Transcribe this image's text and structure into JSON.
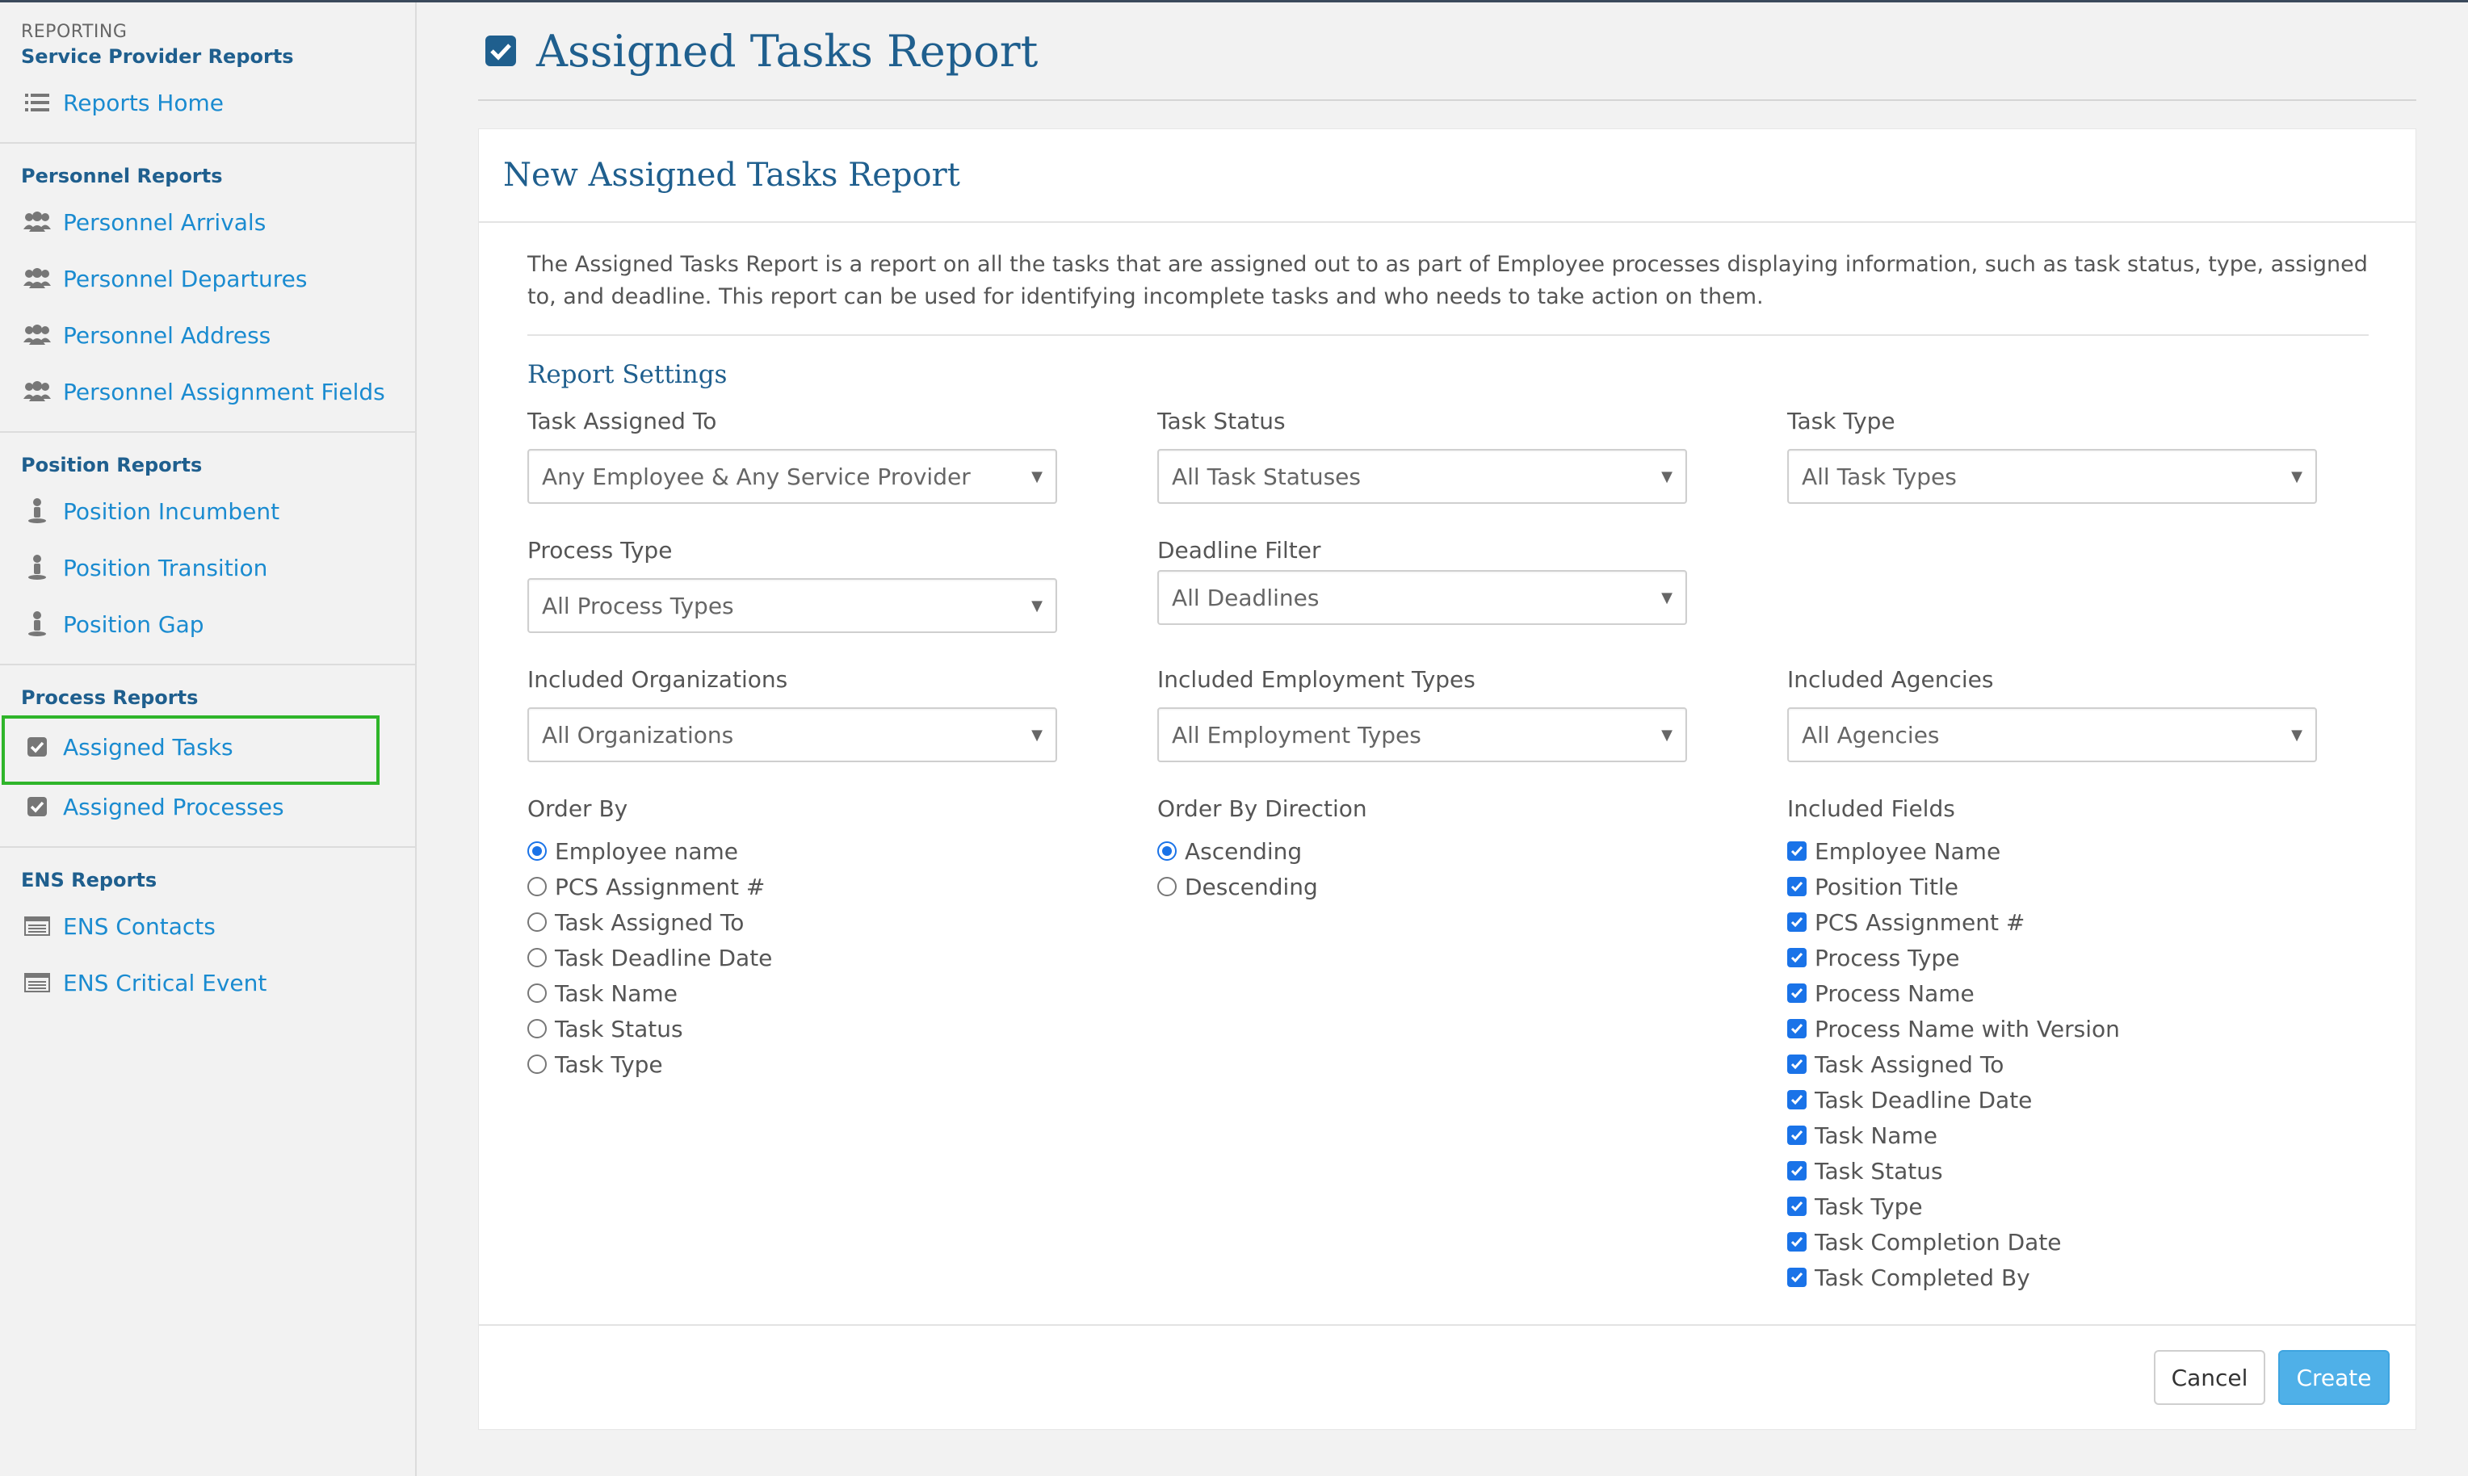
{
  "sidebar": {
    "kicker": "REPORTING",
    "sections": [
      {
        "heading": "Service Provider Reports",
        "items": [
          {
            "label": "Reports Home",
            "icon": "list-icon"
          }
        ]
      },
      {
        "heading": "Personnel Reports",
        "items": [
          {
            "label": "Personnel Arrivals",
            "icon": "users-icon"
          },
          {
            "label": "Personnel Departures",
            "icon": "users-icon"
          },
          {
            "label": "Personnel Address",
            "icon": "users-icon"
          },
          {
            "label": "Personnel Assignment Fields",
            "icon": "users-icon"
          }
        ]
      },
      {
        "heading": "Position Reports",
        "items": [
          {
            "label": "Position Incumbent",
            "icon": "person-pin-icon"
          },
          {
            "label": "Position Transition",
            "icon": "person-pin-icon"
          },
          {
            "label": "Position Gap",
            "icon": "person-pin-icon"
          }
        ]
      },
      {
        "heading": "Process Reports",
        "items": [
          {
            "label": "Assigned Tasks",
            "icon": "checkbox-icon",
            "active": true
          },
          {
            "label": "Assigned Processes",
            "icon": "checkbox-icon"
          }
        ]
      },
      {
        "heading": "ENS Reports",
        "items": [
          {
            "label": "ENS Contacts",
            "icon": "table-icon"
          },
          {
            "label": "ENS Critical Event",
            "icon": "table-icon"
          }
        ]
      }
    ]
  },
  "page": {
    "title": "Assigned Tasks Report"
  },
  "panel": {
    "title": "New Assigned Tasks Report",
    "description": "The Assigned Tasks Report is a report on all the tasks that are assigned out to as part of Employee processes displaying information, such as task status, type, assigned to, and deadline. This report can be used for identifying incomplete tasks and who needs to take action on them.",
    "settings_title": "Report Settings"
  },
  "fields": {
    "task_assigned_to": {
      "label": "Task Assigned To",
      "value": "Any Employee & Any Service Provider"
    },
    "task_status": {
      "label": "Task Status",
      "value": "All Task Statuses"
    },
    "task_type": {
      "label": "Task Type",
      "value": "All Task Types"
    },
    "process_type": {
      "label": "Process Type",
      "value": "All Process Types"
    },
    "deadline_filter": {
      "label": "Deadline Filter",
      "value": "All Deadlines"
    },
    "included_organizations": {
      "label": "Included Organizations",
      "value": "All Organizations"
    },
    "included_employment_types": {
      "label": "Included Employment Types",
      "value": "All Employment Types"
    },
    "included_agencies": {
      "label": "Included Agencies",
      "value": "All Agencies"
    }
  },
  "order_by": {
    "label": "Order By",
    "options": [
      "Employee name",
      "PCS Assignment #",
      "Task Assigned To",
      "Task Deadline Date",
      "Task Name",
      "Task Status",
      "Task Type"
    ],
    "selected": "Employee name"
  },
  "order_direction": {
    "label": "Order By Direction",
    "options": [
      "Ascending",
      "Descending"
    ],
    "selected": "Ascending"
  },
  "included_fields": {
    "label": "Included Fields",
    "options": [
      "Employee Name",
      "Position Title",
      "PCS Assignment #",
      "Process Type",
      "Process Name",
      "Process Name with Version",
      "Task Assigned To",
      "Task Deadline Date",
      "Task Name",
      "Task Status",
      "Task Type",
      "Task Completion Date",
      "Task Completed By"
    ]
  },
  "buttons": {
    "cancel": "Cancel",
    "create": "Create"
  },
  "colors": {
    "accent": "#1a73e8",
    "heading": "#1f5f8e",
    "link": "#1a8bd0",
    "primary_button": "#4fb0e8",
    "active_outline": "#2fb52a"
  }
}
